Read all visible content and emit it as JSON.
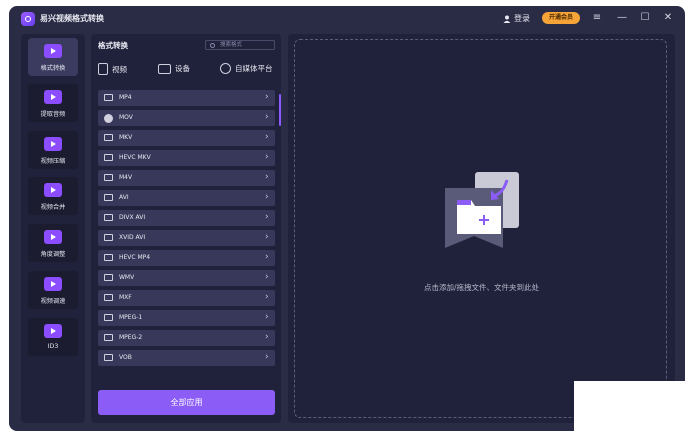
{
  "app": {
    "title": "易兴视频格式转换"
  },
  "header": {
    "login_label": "登录",
    "vip_label": "开通会员",
    "menu_icon": "≡",
    "minimize_icon": "—",
    "maximize_icon": "☐",
    "close_icon": "✕"
  },
  "sidebar": {
    "items": [
      {
        "label": "格式转换",
        "active": true
      },
      {
        "label": "提取音频"
      },
      {
        "label": "视频压缩"
      },
      {
        "label": "视频合并"
      },
      {
        "label": "角度调整"
      },
      {
        "label": "视频调速"
      },
      {
        "label": "ID3"
      }
    ]
  },
  "format_panel": {
    "title": "格式转换",
    "search_placeholder": "搜索格式",
    "tabs": [
      {
        "label": "视频"
      },
      {
        "label": "设备"
      },
      {
        "label": "自媒体平台"
      }
    ],
    "formats": [
      "MP4",
      "MOV",
      "MKV",
      "HEVC MKV",
      "M4V",
      "AVI",
      "DIVX AVI",
      "XVID AVI",
      "HEVC MP4",
      "WMV",
      "MXF",
      "MPEG-1",
      "MPEG-2",
      "VOB"
    ],
    "apply_all_label": "全部应用"
  },
  "dropzone": {
    "hint": "点击添加/拖拽文件、文件夹到此处"
  },
  "colors": {
    "accent": "#8b5cf6",
    "vip": "#f6a338",
    "window": "#2a2b45",
    "panel": "#20213a",
    "row": "#38395a"
  }
}
